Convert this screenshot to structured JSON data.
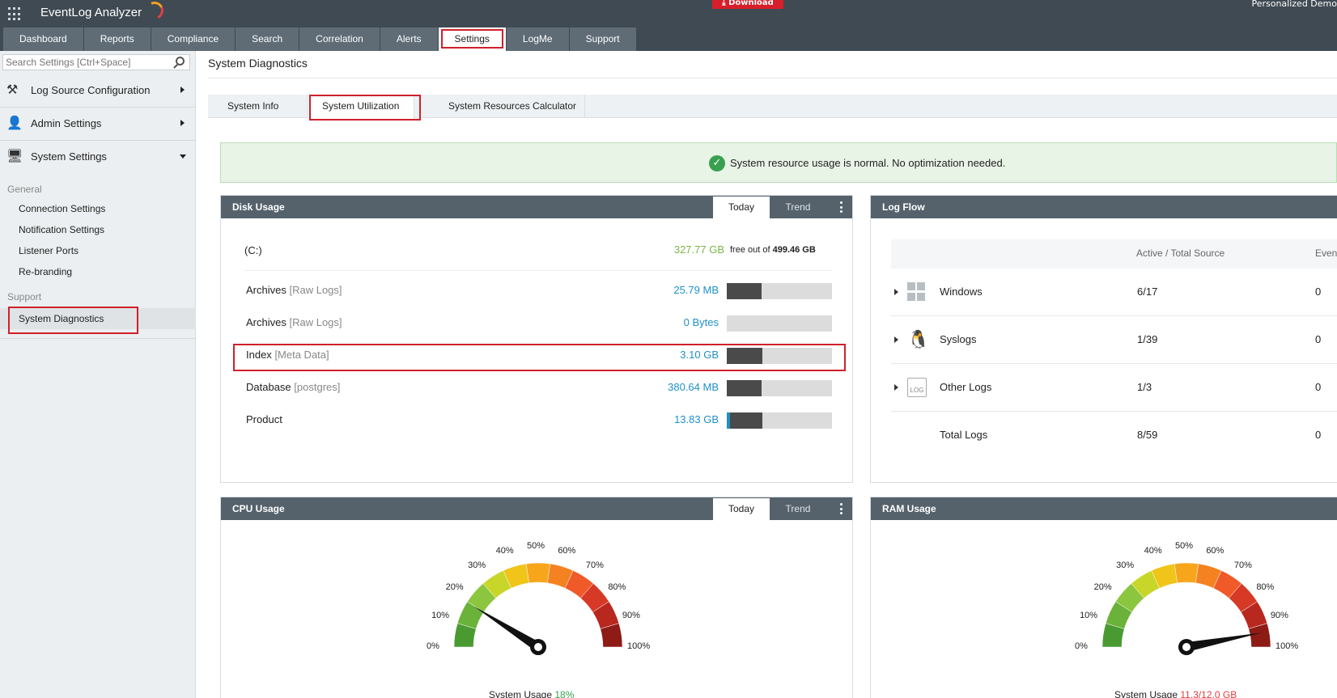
{
  "app": {
    "title": "EventLog Analyzer",
    "download_label": "Download",
    "personalized_label": "Personalized Demo",
    "accent_color": "#d0202a"
  },
  "tabs": [
    {
      "label": "Dashboard"
    },
    {
      "label": "Reports"
    },
    {
      "label": "Compliance"
    },
    {
      "label": "Search"
    },
    {
      "label": "Correlation"
    },
    {
      "label": "Alerts"
    },
    {
      "label": "Settings",
      "active": true
    },
    {
      "label": "LogMe"
    },
    {
      "label": "Support"
    }
  ],
  "sidebar": {
    "search_placeholder": "Search Settings [Ctrl+Space]",
    "items": [
      {
        "label": "Log Source Configuration",
        "icon": "tools-icon"
      },
      {
        "label": "Admin Settings",
        "icon": "user-gear-icon"
      },
      {
        "label": "System Settings",
        "icon": "monitor-gear-icon"
      }
    ],
    "general_label": "General",
    "general_items": [
      "Connection Settings",
      "Notification Settings",
      "Listener Ports",
      "Re-branding"
    ],
    "support_label": "Support",
    "support_items": [
      "System Diagnostics"
    ]
  },
  "main": {
    "title": "System Diagnostics",
    "subtabs": [
      "System Info",
      "System Utilization",
      "System Resources Calculator"
    ],
    "banner": "System resource usage is normal. No optimization needed."
  },
  "disk": {
    "title": "Disk Usage",
    "today_label": "Today",
    "trend_label": "Trend",
    "drive": "(C:)",
    "free": "327.77 GB",
    "free_of_label": "free out of",
    "total": "499.46 GB",
    "rows": [
      {
        "name": "Archives",
        "tag": "[Raw Logs]",
        "value": "25.79 MB",
        "fill_pct": 33
      },
      {
        "name": "Archives",
        "tag": "[Raw Logs]",
        "value": "0 Bytes",
        "fill_pct": 0
      },
      {
        "name": "Index",
        "tag": "[Meta Data]",
        "value": "3.10 GB",
        "fill_pct": 34
      },
      {
        "name": "Database",
        "tag": "[postgres]",
        "value": "380.64 MB",
        "fill_pct": 33
      },
      {
        "name": "Product",
        "tag": "",
        "value": "13.83 GB",
        "fill_pct": 34
      }
    ]
  },
  "logflow": {
    "title": "Log Flow",
    "col_active": "Active / Total Source",
    "col_events": "Even",
    "rows": [
      {
        "name": "Windows",
        "active": "6/17",
        "events": "0",
        "icon": "windows-icon"
      },
      {
        "name": "Syslogs",
        "active": "1/39",
        "events": "0",
        "icon": "linux-icon"
      },
      {
        "name": "Other Logs",
        "active": "1/3",
        "events": "0",
        "icon": "log-file-icon"
      },
      {
        "name": "Total Logs",
        "active": "8/59",
        "events": "0"
      }
    ]
  },
  "cpu": {
    "title": "CPU Usage",
    "today_label": "Today",
    "trend_label": "Trend",
    "caption_label": "System Usage",
    "caption_value": "18%",
    "needle_pct": 18
  },
  "ram": {
    "title": "RAM Usage",
    "caption_label": "System Usage",
    "caption_value": "11.3/12.0 GB",
    "needle_pct": 94
  },
  "gauge_ticks": [
    "0%",
    "10%",
    "20%",
    "30%",
    "40%",
    "50%",
    "60%",
    "70%",
    "80%",
    "90%",
    "100%"
  ],
  "gauge_colors": [
    "#4a9a32",
    "#6ab23a",
    "#8cc63f",
    "#c8d62a",
    "#f0c419",
    "#f7a61c",
    "#f58220",
    "#ef5a28",
    "#d63a26",
    "#b8281f",
    "#8e1b16"
  ]
}
